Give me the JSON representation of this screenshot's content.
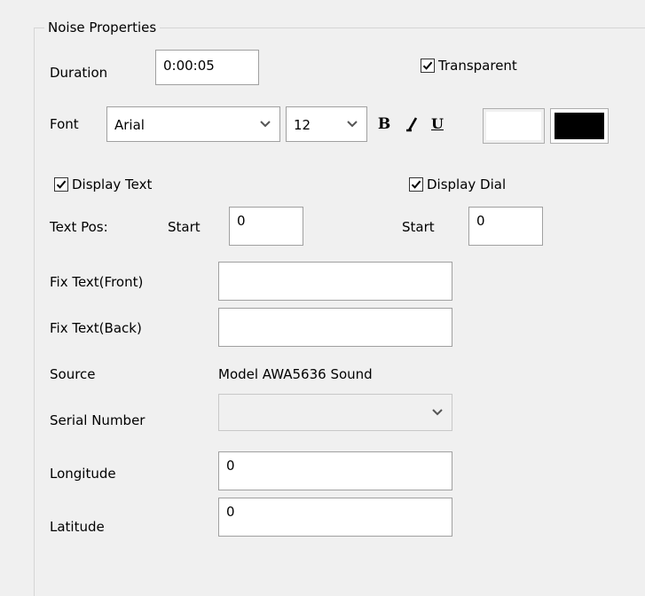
{
  "group": {
    "title": "Noise Properties"
  },
  "duration": {
    "label": "Duration",
    "value": "0:00:05"
  },
  "transparent": {
    "label": "Transparent",
    "checked": true
  },
  "font": {
    "label": "Font",
    "family": "Arial",
    "size": "12",
    "bold_label": "B",
    "italic_label": "I",
    "underline_label": "U",
    "fore_color": "#ffffff",
    "back_color": "#000000"
  },
  "display_text": {
    "label": "Display Text",
    "checked": true
  },
  "display_dial": {
    "label": "Display Dial",
    "checked": true
  },
  "text_pos": {
    "label": "Text Pos:",
    "start_label": "Start",
    "start_value": "0",
    "dial_start_label": "Start",
    "dial_start_value": "0"
  },
  "fix_text_front": {
    "label": "Fix Text(Front)",
    "value": ""
  },
  "fix_text_back": {
    "label": "Fix Text(Back)",
    "value": ""
  },
  "source": {
    "label": "Source",
    "value": "Model AWA5636 Sound"
  },
  "serial_number": {
    "label": "Serial Number",
    "value": ""
  },
  "longitude": {
    "label": "Longitude",
    "value": "0"
  },
  "latitude": {
    "label": "Latitude",
    "value": "0"
  }
}
